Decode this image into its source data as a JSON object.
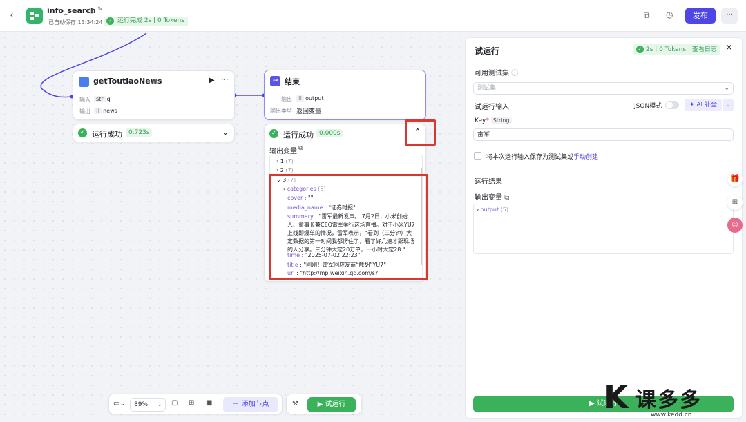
{
  "header": {
    "back_icon": "chevron-left-icon",
    "app_name": "info_search",
    "autosave": "已自动保存 13:34:24",
    "run_status": "运行完成 2s | 0 Tokens",
    "publish_label": "发布",
    "more_label": "···"
  },
  "canvas": {
    "node1": {
      "title": "getToutiaoNews",
      "input_label": "输入",
      "input_type": "str",
      "input_value": "q",
      "output_label": "输出",
      "output_value": "news",
      "run_status": "运行成功",
      "run_time": "0.723s"
    },
    "node2": {
      "title": "结束",
      "output_label": "输出",
      "output_value": "output",
      "output_type_label": "输出类型",
      "output_type_value": "返回变量",
      "run_status": "运行成功",
      "run_time": "0.000s",
      "vars_label": "输出变量",
      "tree": {
        "item1": "1",
        "item1_count": "(7)",
        "item2": "2",
        "item2_count": "(7)",
        "item3": "3",
        "item3_count": "(7)",
        "categories_key": "categories",
        "categories_count": "(5)",
        "cover_key": "cover",
        "cover_val": "\"\"",
        "media_key": "media_name",
        "media_val": "\"证券时报\"",
        "summary_key": "summary",
        "summary_val": "\"雷军最新发声。 7月2日，小米创始人、董事长兼CEO雷军举行这场直播。对于小米YU7上线即爆单的情况，雷军表示，“看到（三分钟）大定数据的第一时间我都愣住了，看了好几遍才跟现场的人分享。三分钟大定20万单，一小时大定28.\"",
        "time_key": "time",
        "time_val": "\"2025-07-02 22:23\"",
        "title_key": "title",
        "title_val": "\"刚刚！雷军回应友商“截胡”YU7\"",
        "url_key": "url",
        "url_val": "\"http://mp.weixin.qq.com/s?"
      }
    }
  },
  "toolbar": {
    "zoom": "89%",
    "add_node": "添加节点",
    "run": "试运行"
  },
  "panel": {
    "title": "试运行",
    "status": "2s | 0 Tokens",
    "log_link": "查看日志",
    "test_set_label": "可用测试集",
    "test_set_placeholder": "测试集",
    "input_label": "试运行输入",
    "json_mode": "JSON模式",
    "ai_fill": "AI 补全",
    "key_label": "Key",
    "key_type": "String",
    "key_value": "雷军",
    "save_text": "将本次运行输入保存为测试集或",
    "manual_create": "手动创建",
    "result_label": "运行结果",
    "output_vars_label": "输出变量",
    "output_key": "output",
    "output_count": "(5)",
    "run_button": "试运行"
  },
  "watermark": {
    "brand": "课多多",
    "url": "www.kedd.cn"
  },
  "colors": {
    "accent": "#4f46e5",
    "green": "#3ab15a",
    "highlight_red": "#d8382f"
  }
}
